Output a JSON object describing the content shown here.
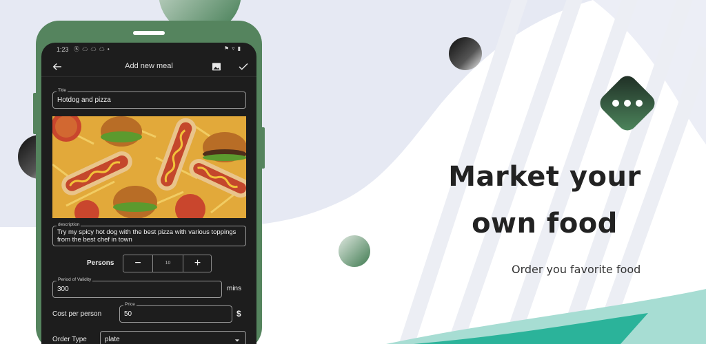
{
  "colors": {
    "accent_green": "#55845e",
    "dark_green": "#2e4d36",
    "teal": "#2bb39a",
    "screen_bg": "#1d1d1d"
  },
  "status_bar": {
    "time": "1:23",
    "notifications": "Ⓢ ☁ ☁ ☁ •",
    "system": "⚑ ▿ ▮"
  },
  "app_bar": {
    "title": "Add new meal",
    "back_icon": "arrow-left-icon",
    "image_icon": "image-icon",
    "save_icon": "check-icon"
  },
  "form": {
    "title_label": "Title",
    "title_value": "Hotdog and pizza",
    "description_label": "description",
    "description_value": "Try my spicy hot dog with the best pizza with various toppings from the best chef in town",
    "persons_label": "Persons",
    "persons_minus": "−",
    "persons_value": "10",
    "persons_plus": "+",
    "validity_label": "Period of Validity",
    "validity_value": "300",
    "validity_unit": "mins",
    "cost_label": "Cost per person",
    "price_label": "Price",
    "price_value": "50",
    "currency": "$",
    "order_type_label": "Order Type",
    "order_type_value": "plate"
  },
  "promo": {
    "headline_line1": "Market your",
    "headline_line2": "own food",
    "tagline": "Order you favorite food"
  }
}
